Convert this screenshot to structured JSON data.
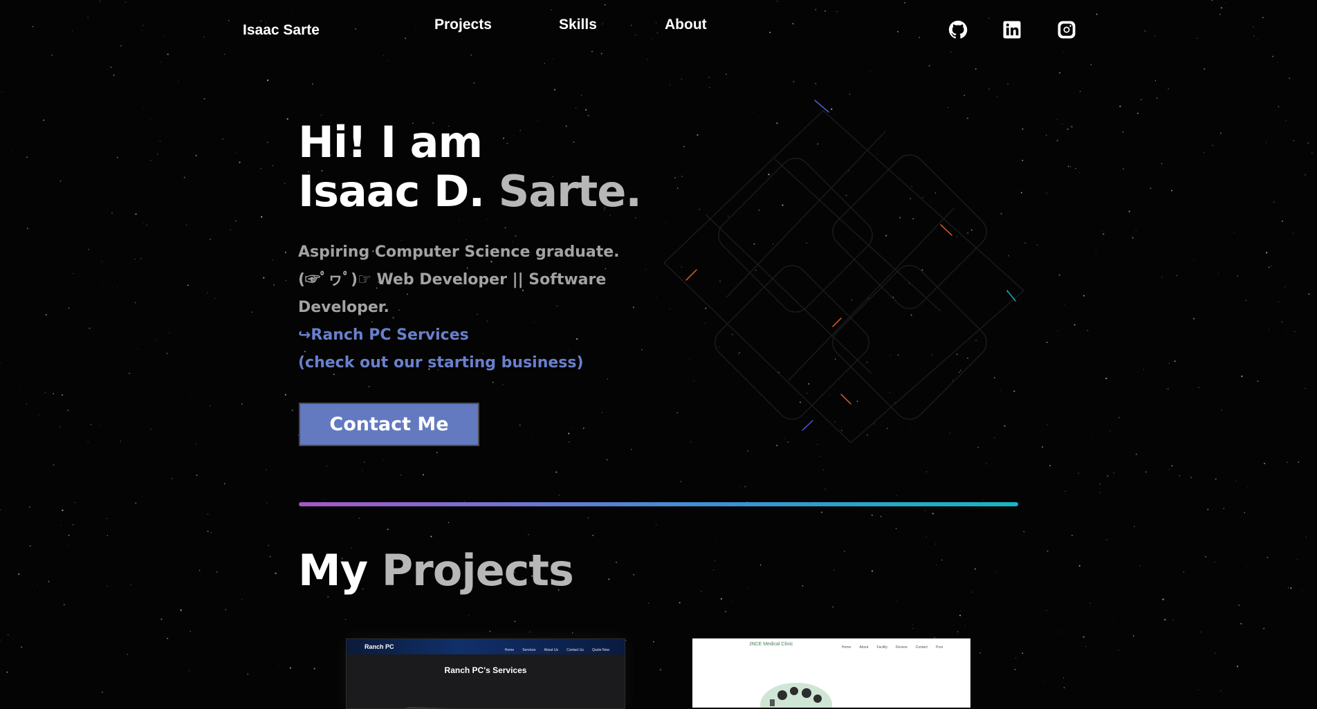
{
  "nav": {
    "brand": "Isaac Sarte",
    "links": [
      "Projects",
      "Skills",
      "About"
    ],
    "social": [
      "github-icon",
      "linkedin-icon",
      "instagram-icon"
    ]
  },
  "hero": {
    "greeting": "Hi! I am",
    "name_first": "Isaac D.",
    "name_last": "Sarte.",
    "desc_line1": "Aspiring Computer Science graduate.",
    "desc_line2": "(☞ﾟヮﾟ)☞ Web Developer || Software Developer.",
    "business_link": "↪Ranch PC Services",
    "business_note": "(check out our starting business)",
    "contact_label": "Contact Me"
  },
  "projects": {
    "title_first": "My",
    "title_last": "Projects",
    "cards": [
      {
        "brand": "Ranch PC",
        "nav": [
          "Home",
          "Services",
          "About Us",
          "Contact Us",
          "Quote Now"
        ],
        "heading": "Ranch PC's Services"
      },
      {
        "brand": "JNCE Medical Clinic",
        "nav": [
          "Home",
          "About",
          "Facility",
          "Review",
          "Contact",
          "Post"
        ]
      }
    ]
  },
  "colors": {
    "background": "#040404",
    "accent": "#6379c0",
    "link": "#6a80cc",
    "muted_text": "#a3a3a3",
    "divider_start": "#a855c8",
    "divider_end": "#15b7c4"
  }
}
